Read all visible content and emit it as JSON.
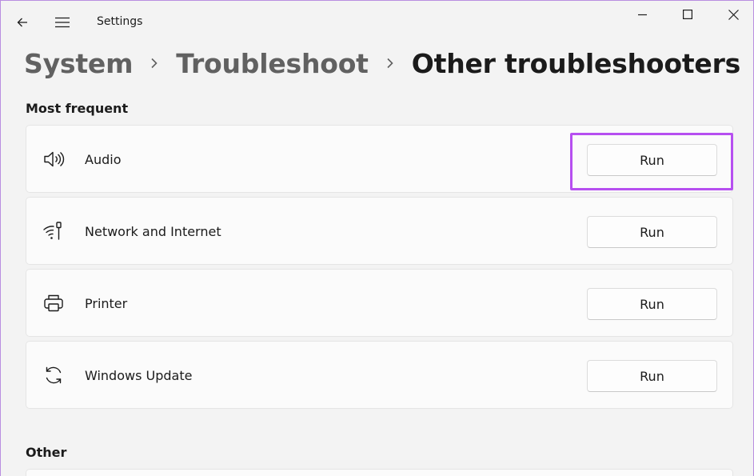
{
  "window": {
    "title": "Settings"
  },
  "breadcrumb": {
    "items": [
      "System",
      "Troubleshoot"
    ],
    "current": "Other troubleshooters"
  },
  "sections": {
    "most_frequent": "Most frequent",
    "other": "Other"
  },
  "troubleshooters": [
    {
      "name": "Audio",
      "icon": "speaker-icon",
      "button": "Run"
    },
    {
      "name": "Network and Internet",
      "icon": "wifi-icon",
      "button": "Run"
    },
    {
      "name": "Printer",
      "icon": "printer-icon",
      "button": "Run"
    },
    {
      "name": "Windows Update",
      "icon": "sync-icon",
      "button": "Run"
    }
  ],
  "colors": {
    "highlight": "#b64ff0",
    "background": "#f3f3f3",
    "card": "#fbfbfb"
  }
}
